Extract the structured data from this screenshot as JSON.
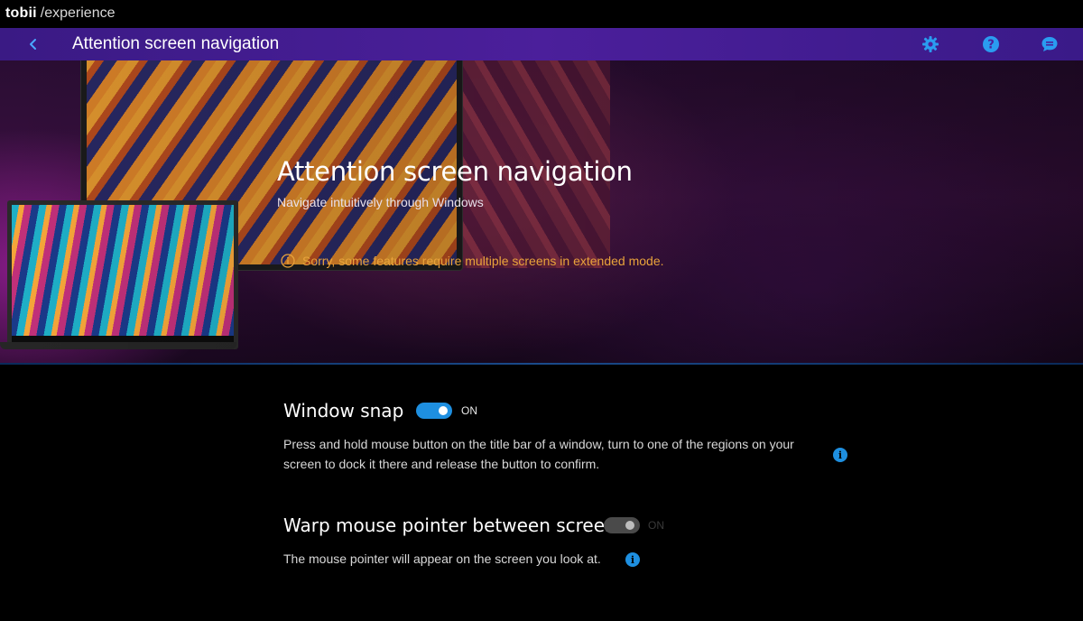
{
  "titlebar": {
    "brand_logo": "tobii",
    "brand_sub": "/experience"
  },
  "header": {
    "title": "Attention screen navigation",
    "icons": [
      "back-icon",
      "gear-icon",
      "help-icon",
      "chat-icon"
    ]
  },
  "hero": {
    "title": "Attention screen navigation",
    "subtitle": "Navigate intuitively through Windows",
    "warning": "Sorry, some features require multiple screens in extended mode."
  },
  "settings": {
    "window_snap": {
      "title": "Window snap",
      "state_label": "ON",
      "enabled": true,
      "description": "Press and hold mouse button on the title bar of a window, turn to one of the regions on your screen to dock it there and release the button to confirm."
    },
    "warp_pointer": {
      "title": "Warp mouse pointer between screens",
      "state_label": "ON",
      "enabled": false,
      "description": "The mouse pointer will appear on the screen you look at."
    }
  },
  "colors": {
    "accent": "#1e8fe0",
    "header_bg": "#4b1f9b",
    "warning": "#e9a33b"
  }
}
